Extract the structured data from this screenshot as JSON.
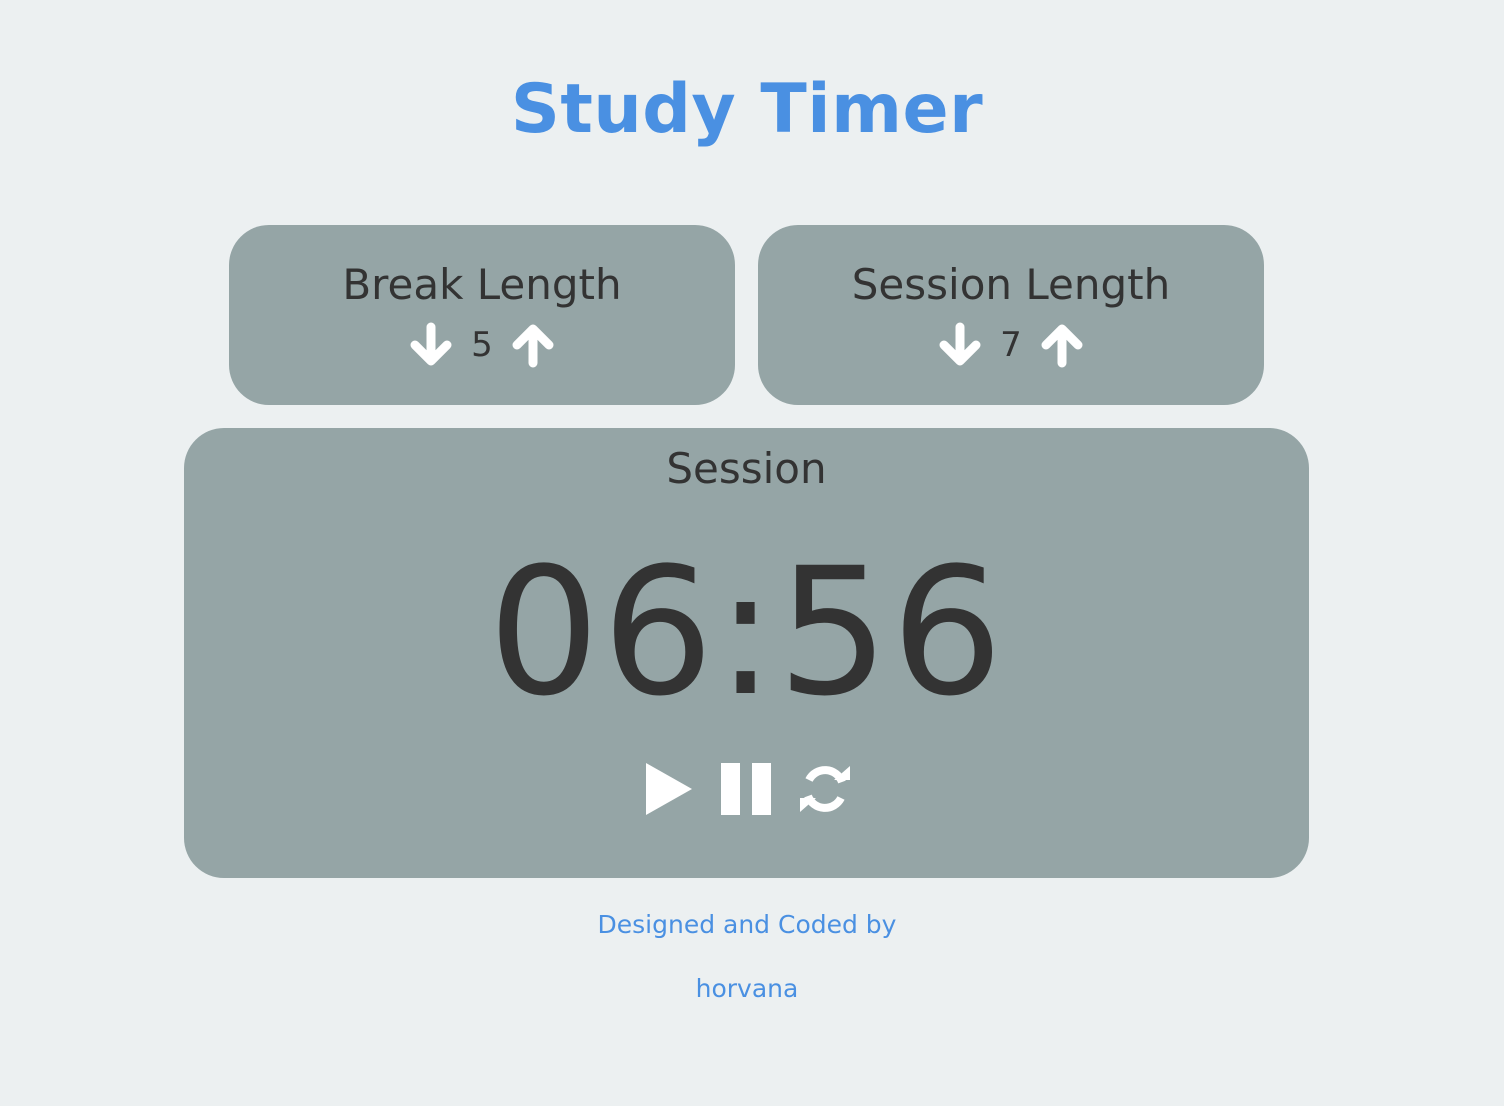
{
  "app": {
    "title": "Study Timer"
  },
  "break_length": {
    "label": "Break Length",
    "value": "5",
    "decrement_icon": "arrow-down-icon",
    "increment_icon": "arrow-up-icon"
  },
  "session_length": {
    "label": "Session Length",
    "value": "7",
    "decrement_icon": "arrow-down-icon",
    "increment_icon": "arrow-up-icon"
  },
  "timer": {
    "label": "Session",
    "time_left": "06:56",
    "controls": {
      "start_icon": "play-icon",
      "pause_icon": "pause-icon",
      "reset_icon": "refresh-icon"
    }
  },
  "footer": {
    "line1": "Designed and Coded by",
    "line2": "horvana"
  },
  "colors": {
    "background": "#ecf0f1",
    "panel": "#95a5a6",
    "accent": "#4a90e2",
    "text": "#333333",
    "icon": "#ffffff"
  }
}
